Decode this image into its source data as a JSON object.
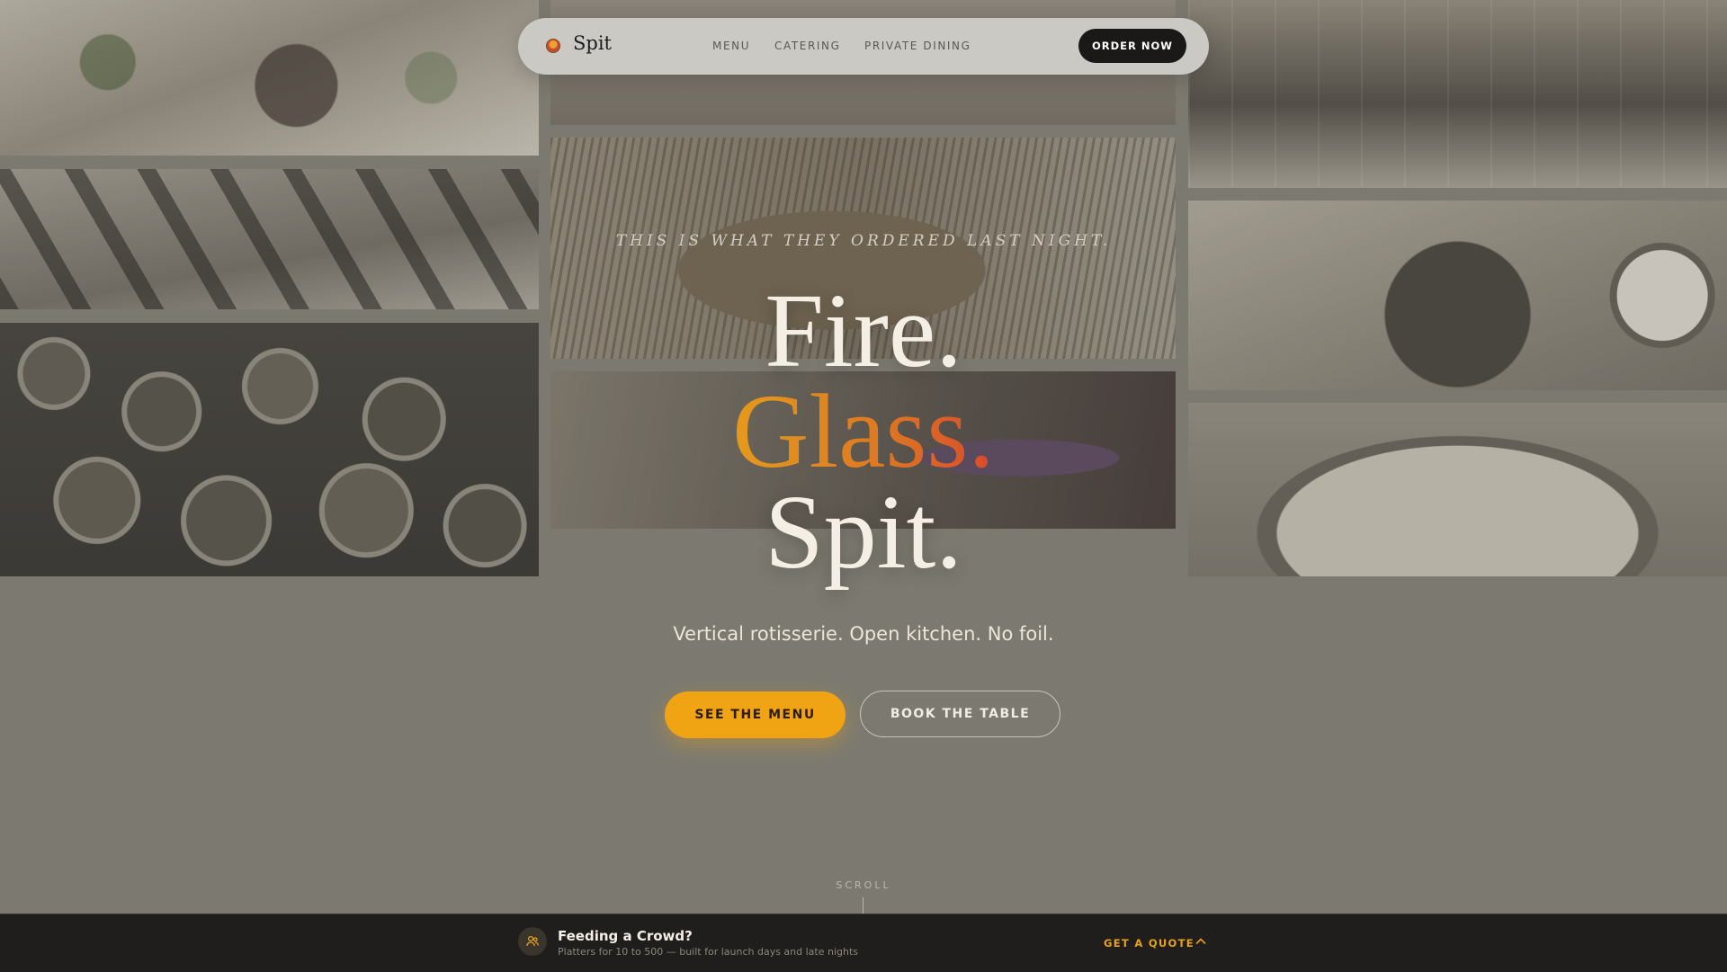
{
  "brand": {
    "name": "Spit"
  },
  "nav": {
    "links": [
      "MENU",
      "CATERING",
      "PRIVATE DINING"
    ],
    "cta": "ORDER NOW"
  },
  "hero": {
    "eyebrow": "THIS IS WHAT THEY ORDERED LAST NIGHT.",
    "lines": [
      "Fire.",
      "Glass.",
      "Spit."
    ],
    "tagline": "Vertical rotisserie. Open kitchen. No foil.",
    "primary_cta": "SEE THE MENU",
    "secondary_cta": "BOOK THE TABLE",
    "scroll_label": "SCROLL"
  },
  "catering_bar": {
    "title": "Feeding a Crowd?",
    "subtitle": "Platters for 10 to 500 — built for launch days and late nights",
    "cta": "GET A QUOTE"
  },
  "colors": {
    "accent": "#f0a313",
    "gradient_start": "#e49a1c",
    "gradient_end": "#d94a2b",
    "bar_bg": "#1f1e1c"
  },
  "icons": [
    "logo-icon",
    "crowd-icon",
    "chevron-up-icon"
  ]
}
